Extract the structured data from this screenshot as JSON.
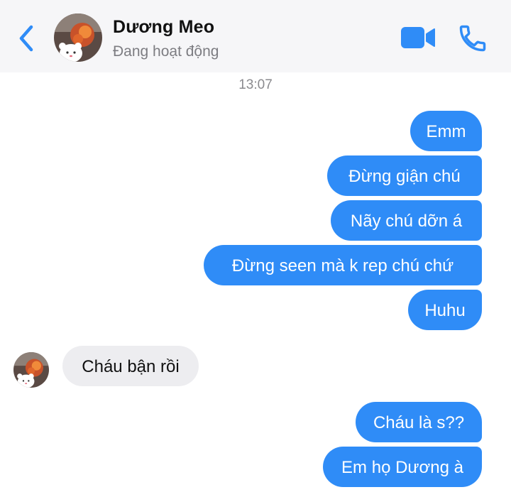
{
  "header": {
    "contact_name": "Dương Meo",
    "status": "Đang hoạt động",
    "back_icon": "chevron-left-icon",
    "video_icon": "video-camera-icon",
    "call_icon": "phone-icon",
    "accent_color": "#2f8cf7"
  },
  "conversation": {
    "timestamp": "13:07",
    "messages_block_1": [
      {
        "text": "Emm",
        "direction": "outgoing"
      },
      {
        "text": "Đừng giận chú",
        "direction": "outgoing"
      },
      {
        "text": "Nãy chú dỡn á",
        "direction": "outgoing"
      },
      {
        "text": "Đừng seen mà k rep chú chứ",
        "direction": "outgoing"
      },
      {
        "text": "Huhu",
        "direction": "outgoing"
      }
    ],
    "incoming": {
      "text": "Cháu bận rồi",
      "direction": "incoming"
    },
    "messages_block_2": [
      {
        "text": "Cháu là s??",
        "direction": "outgoing"
      },
      {
        "text": "Em họ Dương à",
        "direction": "outgoing"
      }
    ]
  },
  "colors": {
    "outgoing_bubble": "#2f8cf7",
    "incoming_bubble": "#ededf0",
    "header_bg": "#f6f6f8"
  }
}
